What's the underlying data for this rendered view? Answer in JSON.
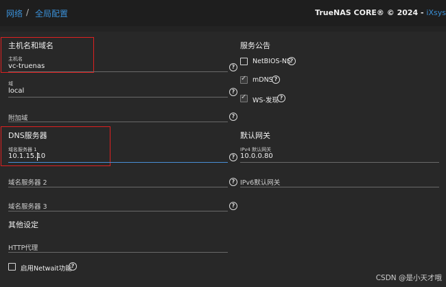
{
  "header": {
    "breadcrumb": [
      "网络",
      "全局配置"
    ],
    "separator": "/",
    "brand": "TrueNAS CORE® © 2024 - ",
    "brand_accent": "iXsys"
  },
  "hostname_section": {
    "title": "主机名和域名",
    "hostname_label": "主机名",
    "hostname_value": "vc-truenas",
    "domain_label": "域",
    "domain_value": "local",
    "additional_domains_label": "附加域"
  },
  "dns_section": {
    "title": "DNS服务器",
    "ns1_label": "域名服务器 1",
    "ns1_value": "10.1.15.10",
    "ns2_label": "域名服务器 2",
    "ns3_label": "域名服务器 3"
  },
  "other_section": {
    "title": "其他设定",
    "http_proxy_label": "HTTP代理",
    "netwait_label": "启用Netwait功能",
    "netwait_checked": false
  },
  "service_section": {
    "title": "服务公告",
    "items": [
      {
        "label": "NetBIOS-NS",
        "checked": false
      },
      {
        "label": "mDNS",
        "checked": true
      },
      {
        "label": "WS-发现",
        "checked": true
      }
    ]
  },
  "gateway_section": {
    "title": "默认网关",
    "ipv4_label": "IPv4 默认网关",
    "ipv4_value": "10.0.0.80",
    "ipv6_label": "IPv6默认网关"
  },
  "help_glyph": "?",
  "check_glyph": "✓",
  "watermark": "CSDN @是小天才哦",
  "colors": {
    "accent": "#3a8fd6",
    "highlight": "#e02020",
    "background": "#282828"
  }
}
